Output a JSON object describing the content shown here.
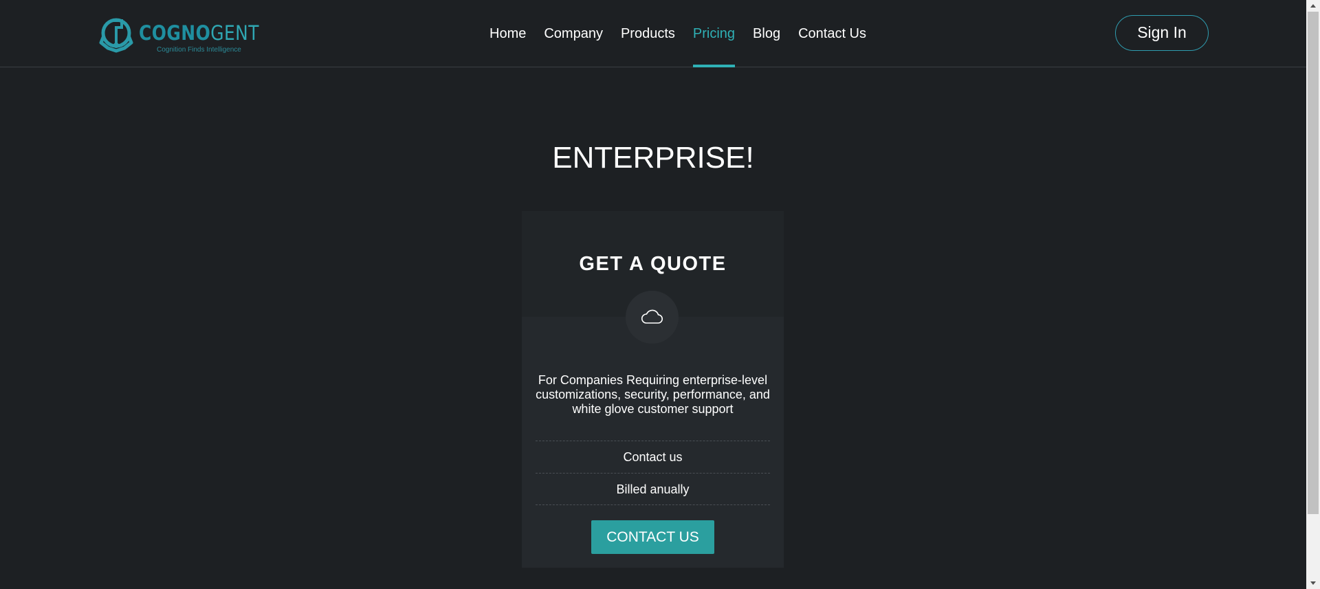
{
  "header": {
    "logo": {
      "name_bold": "COGNO",
      "name_light": "GENT",
      "tagline": "Cognition Finds Intelligence"
    },
    "nav": [
      {
        "label": "Home",
        "active": false
      },
      {
        "label": "Company",
        "active": false
      },
      {
        "label": "Products",
        "active": false
      },
      {
        "label": "Pricing",
        "active": true
      },
      {
        "label": "Blog",
        "active": false
      },
      {
        "label": "Contact Us",
        "active": false
      }
    ],
    "signin_label": "Sign In"
  },
  "main": {
    "title": "ENTERPRISE!",
    "card": {
      "heading": "GET A QUOTE",
      "icon": "cloud-icon",
      "description": "For Companies Requiring enterprise-level customizations, security, performance, and white glove customer support",
      "rows": [
        "Contact us",
        "Billed anually"
      ],
      "button_label": "CONTACT US"
    }
  },
  "colors": {
    "background": "#1d2023",
    "accent": "#2fb1b6",
    "button": "#2b9f9f",
    "card": "#25292d"
  }
}
